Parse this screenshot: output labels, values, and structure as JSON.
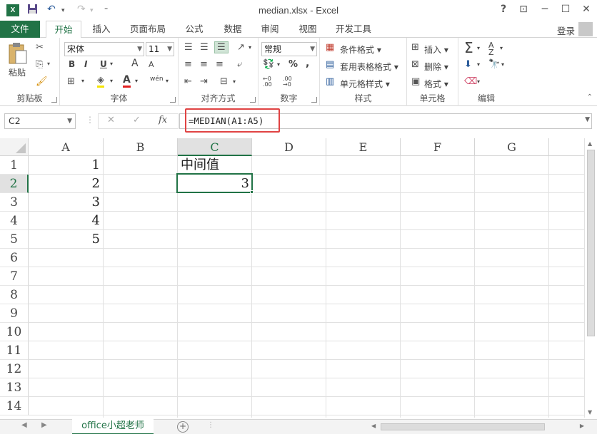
{
  "window": {
    "title": "median.xlsx - Excel",
    "logo": "X",
    "help": "?",
    "restore_ribbon": "⊡",
    "minimize": "─",
    "maximize": "☐",
    "close": "✕"
  },
  "qat": {
    "save": "💾",
    "undo": "↶",
    "redo": "↷",
    "customize": "⇟"
  },
  "tabs": {
    "file": "文件",
    "items": [
      "开始",
      "插入",
      "页面布局",
      "公式",
      "数据",
      "审阅",
      "视图",
      "开发工具"
    ],
    "login": "登录"
  },
  "ribbon": {
    "clipboard": {
      "paste": "粘贴",
      "label": "剪贴板"
    },
    "font": {
      "name": "宋体",
      "size": "11",
      "bold": "B",
      "italic": "I",
      "underline": "U",
      "grow": "A",
      "shrink": "A",
      "wen": "wén",
      "label": "字体"
    },
    "alignment": {
      "label": "对齐方式"
    },
    "number": {
      "format": "常规",
      "percent": "%",
      "comma": ",",
      "label": "数字"
    },
    "styles": {
      "conditional": "条件格式",
      "table": "套用表格格式",
      "cell": "单元格样式",
      "label": "样式"
    },
    "cells": {
      "insert": "插入",
      "delete": "删除",
      "format": "格式",
      "label": "单元格"
    },
    "editing": {
      "label": "编辑"
    }
  },
  "formula_bar": {
    "name_box": "C2",
    "cancel": "✕",
    "enter": "✓",
    "fx": "fx",
    "formula": "=MEDIAN(A1:A5)"
  },
  "grid": {
    "columns": [
      "A",
      "B",
      "C",
      "D",
      "E",
      "F",
      "G"
    ],
    "rows": [
      "1",
      "2",
      "3",
      "4",
      "5",
      "6",
      "7",
      "8",
      "9",
      "10",
      "11",
      "12",
      "13",
      "14"
    ],
    "cells": {
      "A1": "1",
      "A2": "2",
      "A3": "3",
      "A4": "4",
      "A5": "5",
      "C1": "中间值",
      "C2": "3"
    },
    "active_cell": "C2",
    "selected_column": "C",
    "selected_row": "2"
  },
  "sheets": {
    "active": "office小超老师",
    "add": "+"
  },
  "colors": {
    "accent": "#217346",
    "highlight_box": "#e04343"
  }
}
